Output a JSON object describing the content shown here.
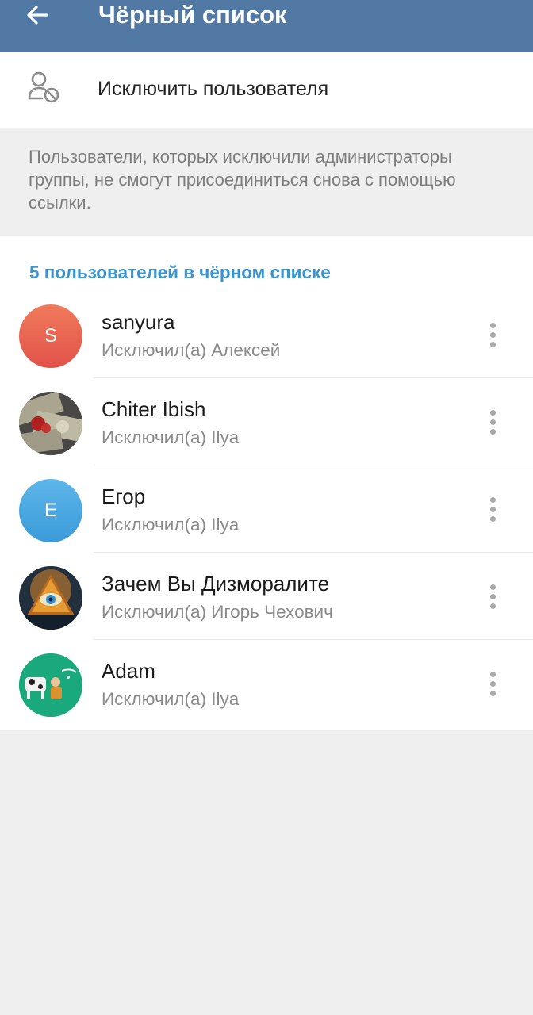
{
  "header": {
    "title": "Чёрный список",
    "back_icon": "arrow-left-icon"
  },
  "kick_action": {
    "label": "Исключить пользователя",
    "icon": "user-block-icon"
  },
  "info": {
    "text": "Пользователи, которых исключили администраторы группы, не смогут присоединиться снова с помощью ссылки."
  },
  "list": {
    "header": "5 пользователей в чёрном списке",
    "users": [
      {
        "name": "sanyura",
        "removed_by": "Исключил(а) Алексей",
        "initial": "S",
        "avatar_color": "#e8624f"
      },
      {
        "name": "Chiter Ibish",
        "removed_by": "Исключил(а) Ilya",
        "initial": "",
        "avatar_color": "#6e6b66"
      },
      {
        "name": "Егор",
        "removed_by": "Исключил(а) Ilya",
        "initial": "E",
        "avatar_color": "#3fa2de"
      },
      {
        "name": "Зачем Вы Дизморалите",
        "removed_by": "Исключил(а) Игорь Чехович",
        "initial": "",
        "avatar_color": "#2a3b4a"
      },
      {
        "name": "Adam",
        "removed_by": "Исключил(а) Ilya",
        "initial": "",
        "avatar_color": "#1ea67a"
      }
    ]
  },
  "colors": {
    "topbar": "#5279a3",
    "accent": "#3a95cf",
    "background": "#efefef"
  }
}
